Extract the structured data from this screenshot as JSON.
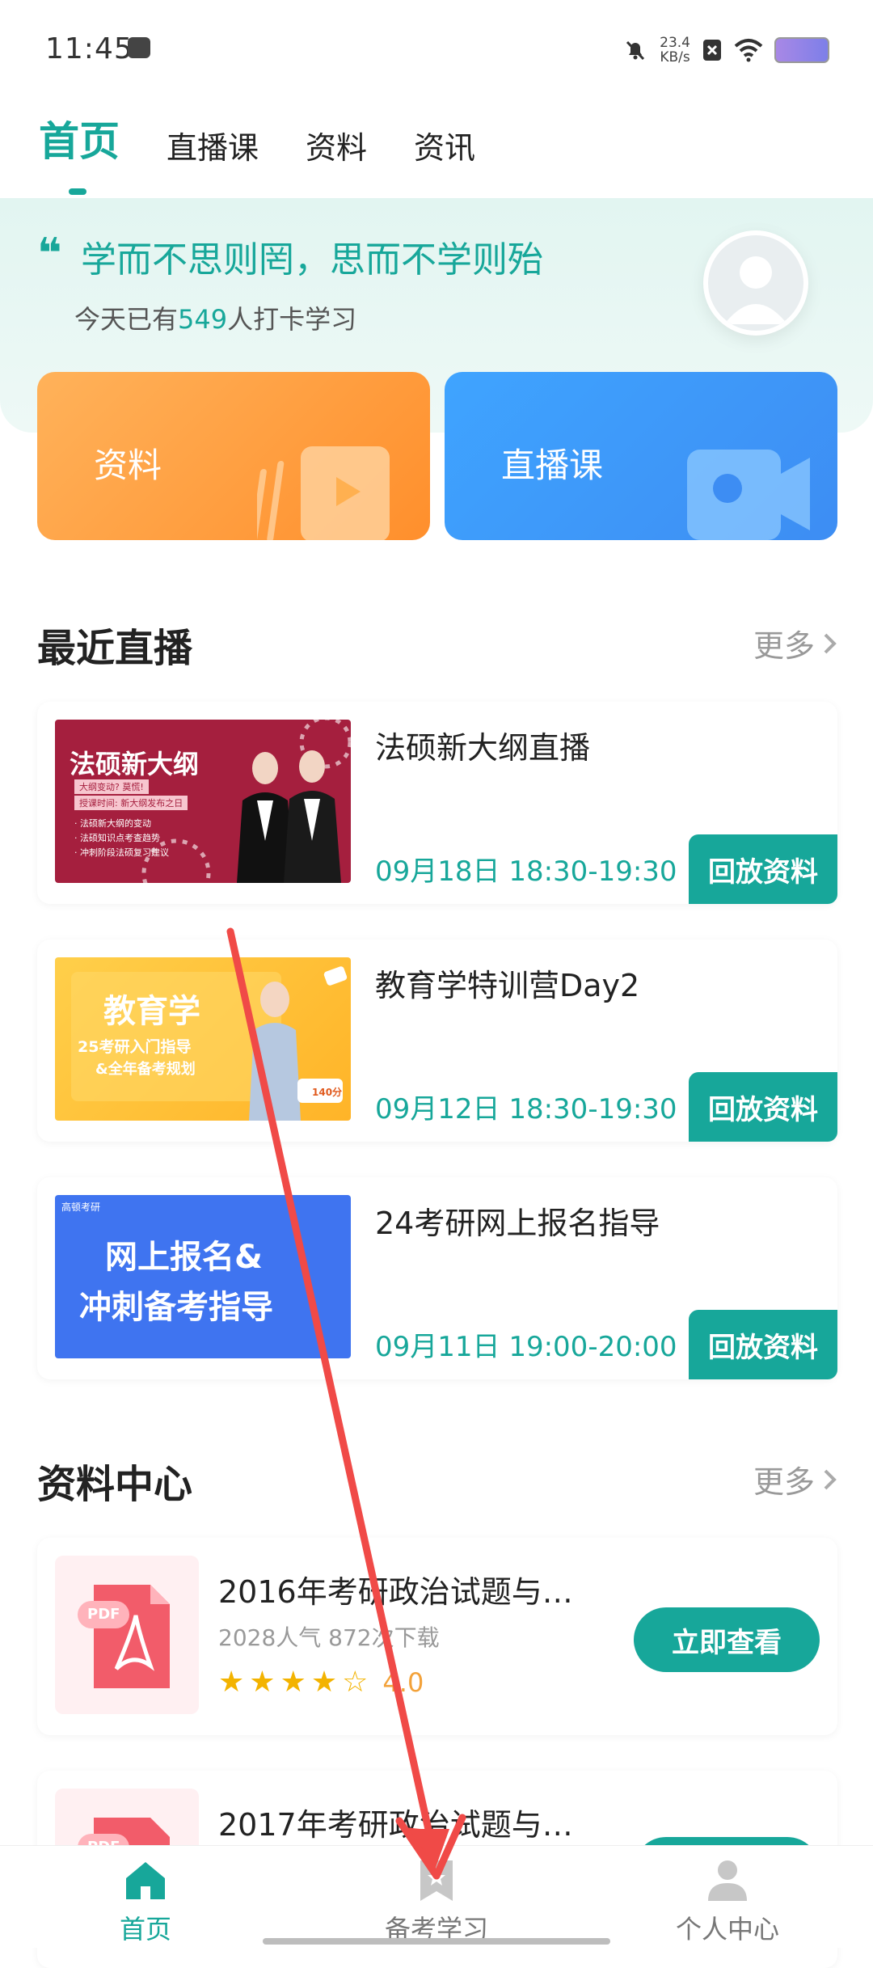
{
  "status_bar": {
    "time": "11:45",
    "speed_value": "23.4",
    "speed_unit": "KB/s"
  },
  "top_tabs": [
    {
      "label": "首页",
      "active": true
    },
    {
      "label": "直播课",
      "active": false
    },
    {
      "label": "资料",
      "active": false
    },
    {
      "label": "资讯",
      "active": false
    }
  ],
  "hero": {
    "quote_mark": "❝",
    "quote": "学而不思则罔，思而不学则殆",
    "checkin_prefix": "今天已有",
    "checkin_count": "549",
    "checkin_suffix": "人打卡学习"
  },
  "quick_cards": [
    {
      "label": "资料",
      "color": "#ff9a3a"
    },
    {
      "label": "直播课",
      "color": "#3f98fb"
    }
  ],
  "recent_live": {
    "title": "最近直播",
    "more": "更多",
    "items": [
      {
        "title": "法硕新大纲直播",
        "time": "09月18日 18:30-19:30",
        "button": "回放资料",
        "thumb_text": "法硕新大纲",
        "thumb_lines": [
          "大纲变动? 莫慌!",
          "授课时间: 新大纲发布之日",
          "· 法硕新大纲的变动",
          "· 法硕知识点考查趋势",
          "· 冲刺阶段法硕复习建议"
        ]
      },
      {
        "title": "教育学特训营Day2",
        "time": "09月12日 18:30-19:30",
        "button": "回放资料",
        "thumb_text": "教育学",
        "thumb_lines": [
          "25考研入门指导",
          "&全年备考规划",
          "140分"
        ]
      },
      {
        "title": "24考研网上报名指导",
        "time": "09月11日 19:00-20:00",
        "button": "回放资料",
        "thumb_text": "网上报名&",
        "thumb_lines": [
          "冲刺备考指导",
          "高顿考研"
        ]
      }
    ]
  },
  "resource_center": {
    "title": "资料中心",
    "more": "更多",
    "items": [
      {
        "title": "2016年考研政治试题与…",
        "meta": "2028人气 872次下载",
        "rating": "4.0",
        "button": "立即查看",
        "pdf_label": "PDF"
      },
      {
        "title": "2017年考研政治试题与…",
        "pdf_label": "PDF"
      }
    ]
  },
  "bottom_nav": [
    {
      "label": "首页",
      "icon": "home-icon",
      "active": true
    },
    {
      "label": "备考学习",
      "icon": "bookmark-star-icon",
      "active": false
    },
    {
      "label": "个人中心",
      "icon": "person-icon",
      "active": false
    }
  ],
  "colors": {
    "accent": "#17a79a",
    "star": "#f3b300",
    "annotation_arrow": "#f04a47"
  }
}
